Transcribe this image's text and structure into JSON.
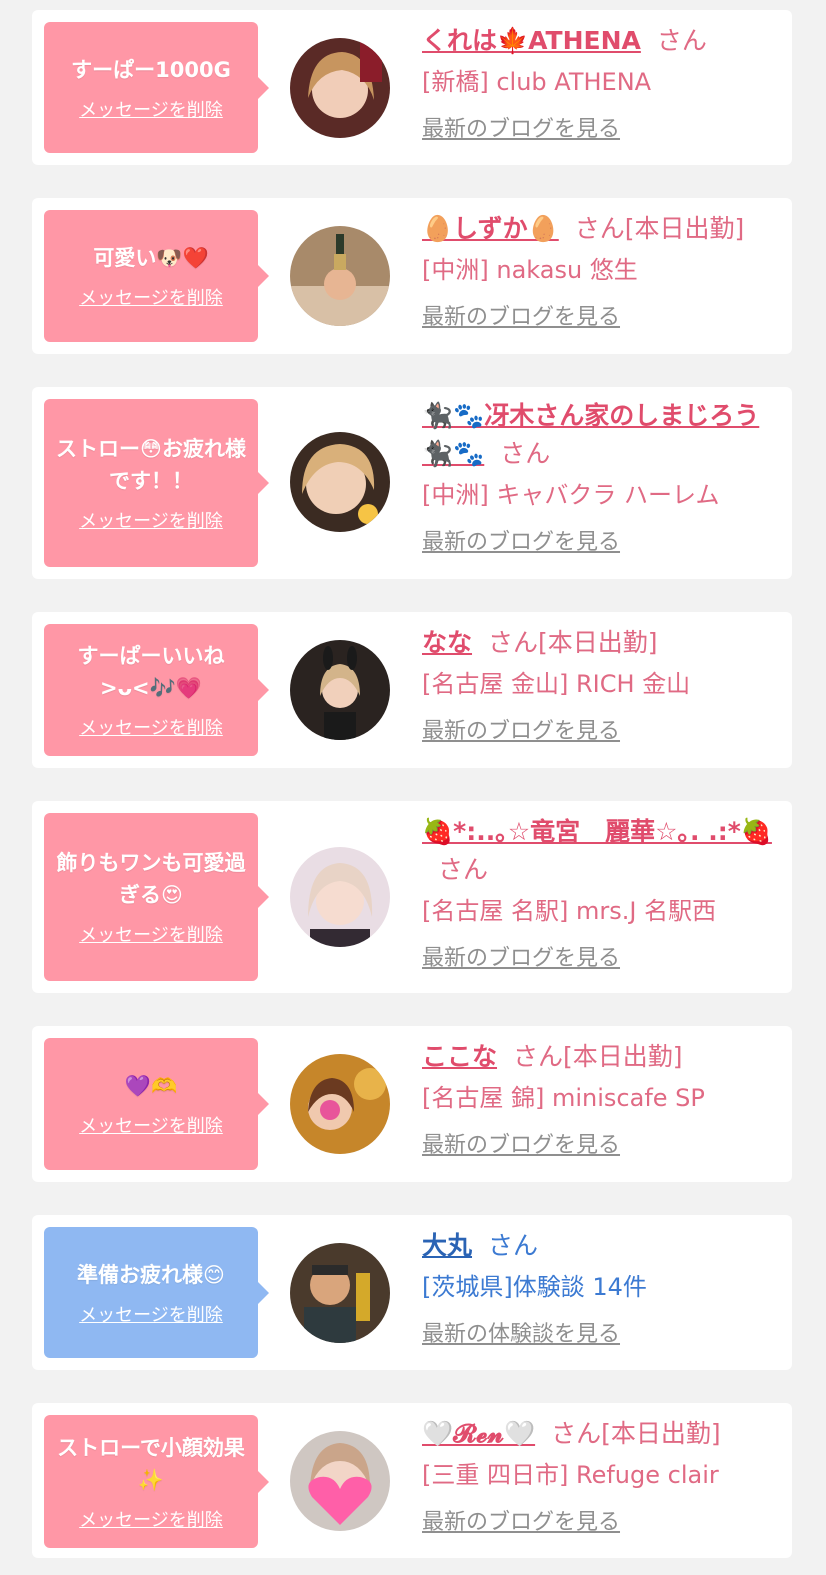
{
  "theme": {
    "pink_bubble": "#ff97a6",
    "blue_bubble": "#8fb8f2",
    "name_pink": "#e04c6c",
    "name_blue": "#2a63b4",
    "link_gray": "#8f8f8f"
  },
  "delete_label": "メッセージを削除",
  "san_label": "さん",
  "items": [
    {
      "message": "すーぱー1000G",
      "name": "くれは🍁ATHENA",
      "status": "",
      "shop": "[新橋] club ATHENA",
      "link": "最新のブログを見る",
      "bubble": "pink",
      "avatar_icon": "cast-photo"
    },
    {
      "message": "可愛い🐶❤️",
      "name": "🥚しずか🥚",
      "status": "[本日出勤]",
      "shop": "[中洲] nakasu 悠生",
      "link": "最新のブログを見る",
      "bubble": "pink",
      "avatar_icon": "cast-photo"
    },
    {
      "message": "ストロー😳お疲れ様です！！",
      "name": "🐈‍⬛🐾冴木さん家のしまじろう🐈‍⬛🐾",
      "status": "",
      "shop": "[中洲] キャバクラ ハーレム",
      "link": "最新のブログを見る",
      "bubble": "pink",
      "avatar_icon": "cast-photo"
    },
    {
      "message": "すーぱーいいね>ᴗ<🎶💗",
      "name": "なな",
      "status": "[本日出勤]",
      "shop": "[名古屋 金山] RICH 金山",
      "link": "最新のブログを見る",
      "bubble": "pink",
      "avatar_icon": "cast-photo"
    },
    {
      "message": "飾りもワンも可愛過ぎる😍",
      "name": "🍓*:..｡☆竜宮　麗華☆｡. .:*🍓",
      "status": "",
      "shop": "[名古屋 名駅] mrs.J 名駅西",
      "link": "最新のブログを見る",
      "bubble": "pink",
      "avatar_icon": "cast-photo"
    },
    {
      "message": "💜🫶",
      "name": "ここな",
      "status": "[本日出勤]",
      "shop": "[名古屋 錦] miniscafe SP",
      "link": "最新のブログを見る",
      "bubble": "pink",
      "avatar_icon": "cast-photo"
    },
    {
      "message": "準備お疲れ様😊",
      "name": "大丸",
      "status": "",
      "shop": "[茨城県]体験談 14件",
      "link": "最新の体験談を見る",
      "bubble": "blue",
      "avatar_icon": "user-photo"
    },
    {
      "message": "ストローで小顔効果✨",
      "name": "🤍𝓡𝓮𝓷🤍",
      "status": "[本日出勤]",
      "shop": "[三重 四日市] Refuge clair",
      "link": "最新のブログを見る",
      "bubble": "pink",
      "avatar_icon": "cast-photo"
    }
  ]
}
